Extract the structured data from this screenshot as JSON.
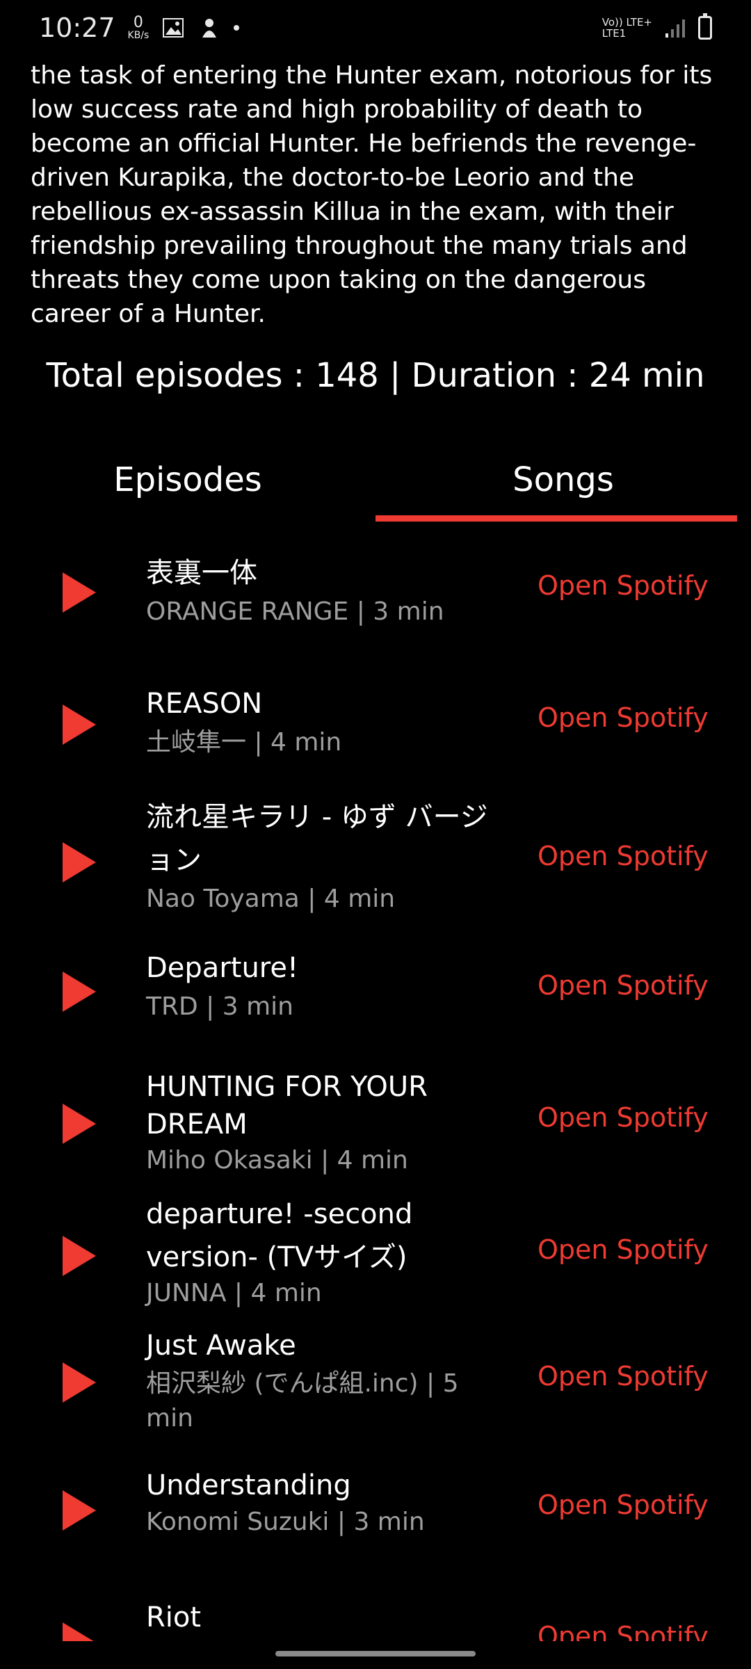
{
  "status_bar": {
    "time": "10:27",
    "kbs_value": "0",
    "kbs_unit": "KB/s",
    "network_line1": "Vo)) LTE+",
    "network_line2": "LTE1"
  },
  "description": "the task of entering the Hunter exam, notorious for its low success rate and high probability of death to become an official Hunter. He befriends the revenge-driven Kurapika, the doctor-to-be Leorio and the rebellious ex-assassin Killua in the exam, with their friendship prevailing throughout the many trials and threats they come upon taking on the dangerous career of a Hunter.",
  "summary": "Total episodes : 148 | Duration : 24 min",
  "tabs": [
    {
      "label": "Episodes",
      "selected": false
    },
    {
      "label": "Songs",
      "selected": true
    }
  ],
  "accent_color": "#ef3b32",
  "songs": [
    {
      "title": "表裏一体",
      "meta": "ORANGE RANGE | 3 min",
      "action": "Open Spotify"
    },
    {
      "title": "REASON",
      "meta": "土岐隼一 | 4 min",
      "action": "Open Spotify"
    },
    {
      "title": "流れ星キラリ - ゆず バージョン",
      "meta": "Nao Toyama | 4 min",
      "action": "Open Spotify"
    },
    {
      "title": "Departure!",
      "meta": "TRD | 3 min",
      "action": "Open Spotify"
    },
    {
      "title": "HUNTING FOR YOUR DREAM",
      "meta": "Miho Okasaki | 4 min",
      "action": "Open Spotify"
    },
    {
      "title": "departure! -second version- (TVサイズ)",
      "meta": "JUNNA | 4 min",
      "action": "Open Spotify"
    },
    {
      "title": "Just Awake",
      "meta": "相沢梨紗 (でんぱ組.inc) | 5 min",
      "action": "Open Spotify"
    },
    {
      "title": "Understanding",
      "meta": "Konomi Suzuki | 3 min",
      "action": "Open Spotify"
    },
    {
      "title": "Riot",
      "meta": "",
      "action": "Open Spotify"
    }
  ]
}
